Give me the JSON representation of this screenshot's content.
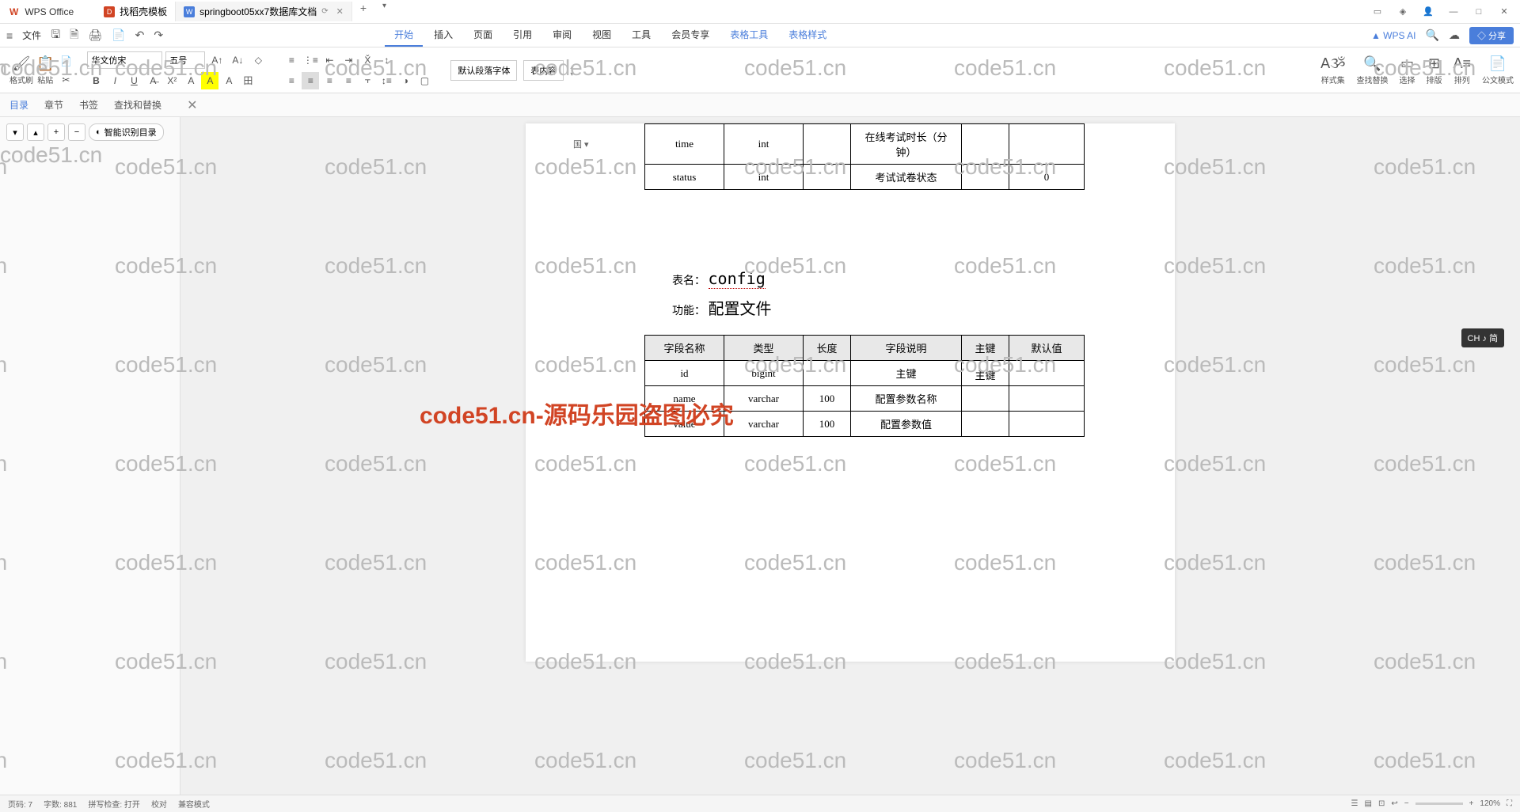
{
  "app": {
    "logo": "W",
    "name": "WPS Office"
  },
  "tabs": [
    {
      "icon": "D",
      "label": "找稻壳模板"
    },
    {
      "icon": "W",
      "label": "springboot05xx7数据库文档"
    }
  ],
  "windowControls": {
    "min": "—",
    "max": "□",
    "close": "✕"
  },
  "menubar": {
    "hamburger": "≡",
    "file": "文件",
    "tabs": [
      "开始",
      "插入",
      "页面",
      "引用",
      "审阅",
      "视图",
      "工具",
      "会员专享",
      "表格工具",
      "表格样式"
    ],
    "wpsai": "WPS AI",
    "share": "分享"
  },
  "toolbar": {
    "formatPainter": "格式刷",
    "paste": "粘贴",
    "font": "华文仿宋",
    "fontSize": "五号",
    "paraStyle1": "默认段落字体",
    "paraStyle2": "表内容",
    "styleSet": "样式集",
    "findReplace": "查找替换",
    "select": "选择",
    "sort": "排版",
    "arrange": "排列",
    "docMode": "公文模式"
  },
  "navTabs": {
    "toc": "目录",
    "chapter": "章节",
    "bookmark": "书签",
    "findReplace": "查找和替换"
  },
  "sidebar": {
    "smartToc": "智能识别目录"
  },
  "document": {
    "tableIndicator": "国 ▾",
    "topTable": {
      "rows": [
        [
          "time",
          "int",
          "",
          "在线考试时长（分钟）",
          "",
          ""
        ],
        [
          "status",
          "int",
          "",
          "考试试卷状态",
          "",
          "0"
        ]
      ]
    },
    "tableNameLabel": "表名：",
    "tableName": "config",
    "funcLabel": "功能：",
    "funcName": "配置文件",
    "configTable": {
      "headers": [
        "字段名称",
        "类型",
        "长度",
        "字段说明",
        "主键",
        "默认值"
      ],
      "rows": [
        [
          "id",
          "bigint",
          "",
          "主键",
          "主键",
          ""
        ],
        [
          "name",
          "varchar",
          "100",
          "配置参数名称",
          "",
          ""
        ],
        [
          "value",
          "varchar",
          "100",
          "配置参数值",
          "",
          ""
        ]
      ]
    }
  },
  "watermark": {
    "text": "code51.cn",
    "red": "code51.cn-源码乐园盗图必究"
  },
  "statusbar": {
    "page": "页码: 7",
    "wordCount": "字数: 881",
    "spellCheck": "拼写检查: 打开",
    "proofread": "校对",
    "mode": "兼容模式",
    "zoom": "120%"
  },
  "ime": "CH ♪ 简"
}
